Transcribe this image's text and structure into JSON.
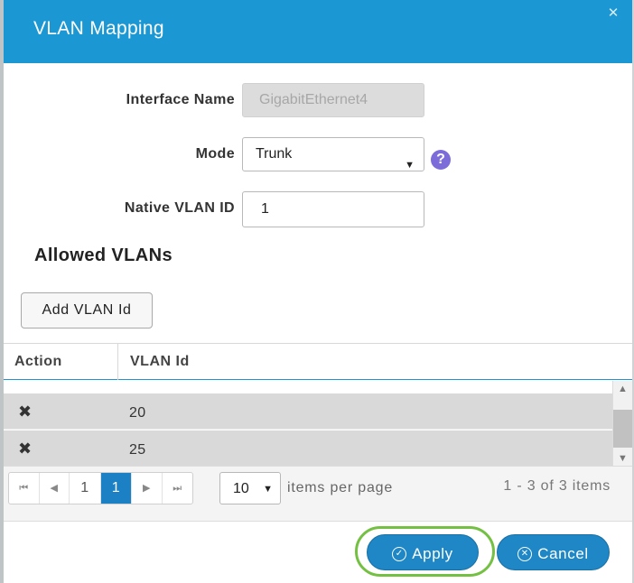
{
  "dialog": {
    "title": "VLAN Mapping",
    "close_glyph": "✕"
  },
  "form": {
    "interface_name_label": "Interface Name",
    "interface_name_value": "GigabitEthernet4",
    "mode_label": "Mode",
    "mode_value": "Trunk",
    "help_glyph": "?",
    "native_vlan_label": "Native VLAN ID",
    "native_vlan_value": "1"
  },
  "allowed": {
    "title": "Allowed VLANs",
    "add_button": "Add VLAN Id"
  },
  "grid": {
    "columns": [
      "Action",
      "VLAN Id"
    ],
    "rows": [
      {
        "action_glyph": "✖",
        "vlan_id": "20"
      },
      {
        "action_glyph": "✖",
        "vlan_id": "25"
      }
    ]
  },
  "pager": {
    "first": "⏮",
    "prev": "◀",
    "pages": [
      "1",
      "1"
    ],
    "next": "▶",
    "last": "⏭",
    "page_size": "10",
    "per_page_label": "items per page",
    "range_label": "1 - 3 of 3 items"
  },
  "footer": {
    "apply_label": "Apply",
    "cancel_label": "Cancel"
  },
  "colors": {
    "header": "#1b97d4",
    "primary_button": "#1f87c5",
    "highlight_ring": "#74c043",
    "help_badge": "#7b6cd9"
  },
  "icons": {
    "close": "close-icon",
    "help": "help-icon",
    "delete": "delete-icon",
    "apply": "check-circle-icon",
    "cancel": "x-circle-icon"
  }
}
